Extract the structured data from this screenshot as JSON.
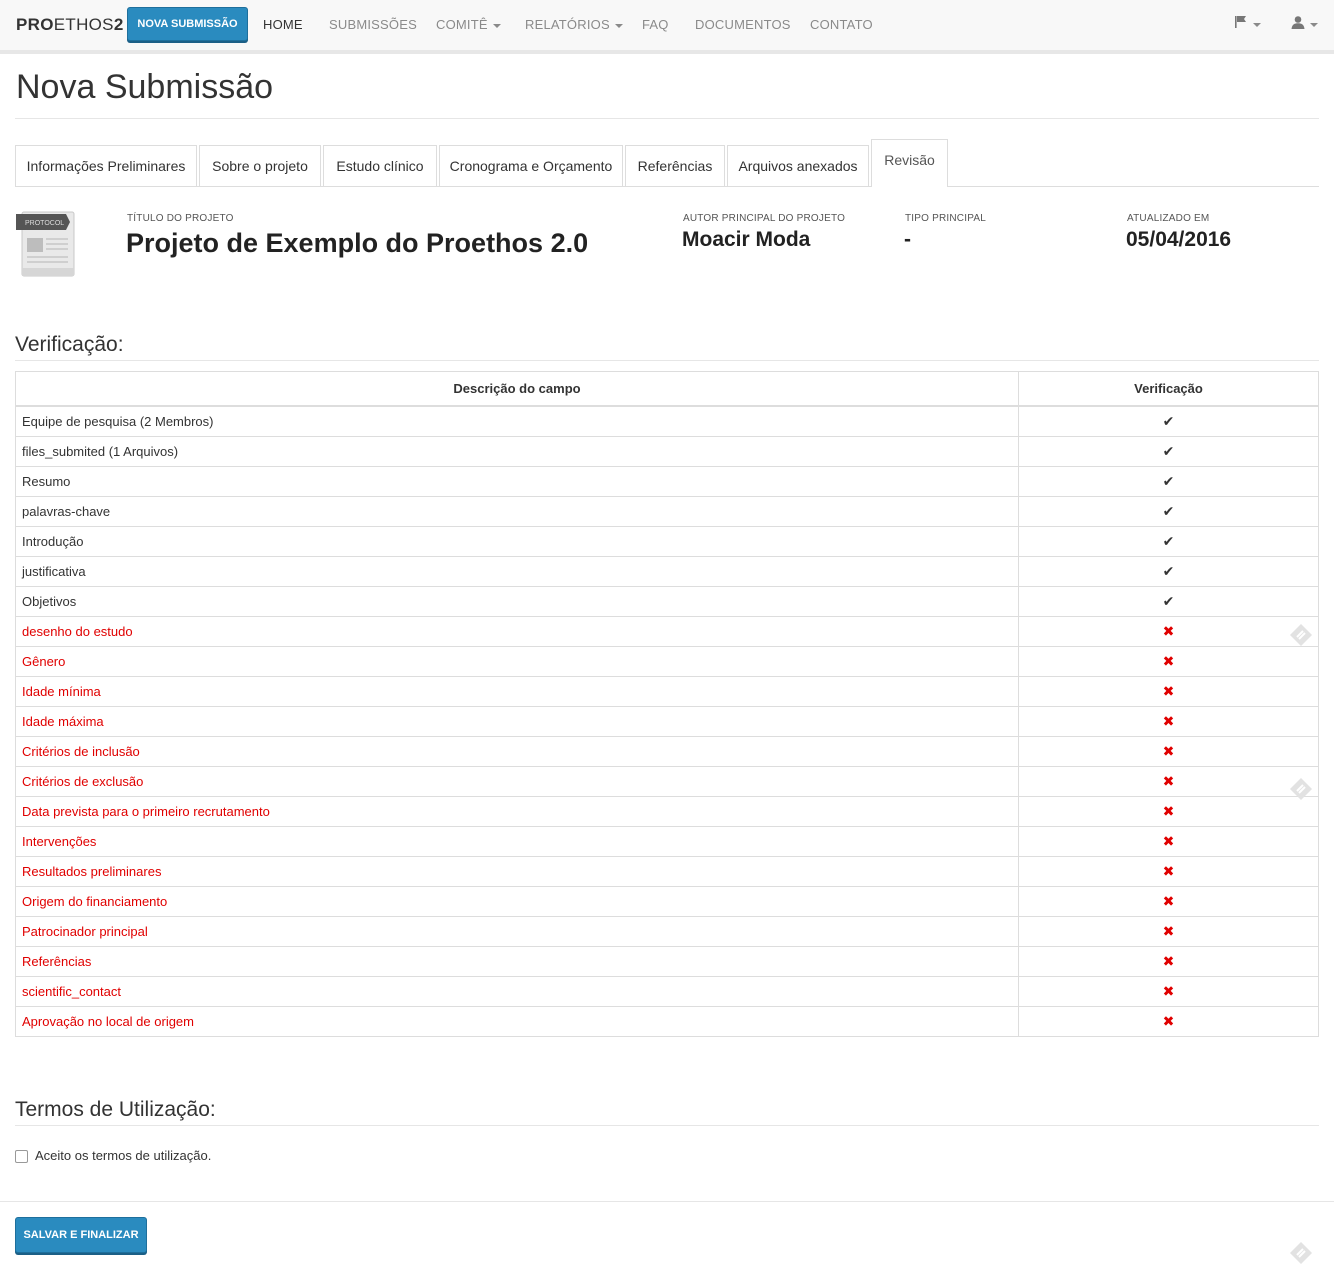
{
  "navbar": {
    "brand_bold": "PRO",
    "brand_thin": "ETHOS",
    "brand_bold2": "2",
    "nova_submissao": "NOVA SUBMISSÃO",
    "items": [
      "HOME",
      "SUBMISSÕES",
      "COMITÊ",
      "RELATÓRIOS",
      "FAQ",
      "DOCUMENTOS",
      "CONTATO"
    ],
    "icons": [
      "flag-icon",
      "user-icon"
    ]
  },
  "page": {
    "title": "Nova Submissão"
  },
  "tabs": [
    "Informações Preliminares",
    "Sobre o projeto",
    "Estudo clínico",
    "Cronograma e Orçamento",
    "Referências",
    "Arquivos anexados",
    "Revisão"
  ],
  "active_tab": "Revisão",
  "project": {
    "icon_label": "PROTOCOL",
    "title_label": "TÍTULO DO PROJETO",
    "title": "Projeto de Exemplo do Proethos 2.0",
    "author_label": "AUTOR PRINCIPAL DO PROJETO",
    "author": "Moacir Moda",
    "type_label": "TIPO PRINCIPAL",
    "type": "-",
    "updated_label": "ATUALIZADO EM",
    "updated": "05/04/2016"
  },
  "verification": {
    "heading": "Verificação:",
    "col_desc": "Descrição do campo",
    "col_check": "Verificação",
    "rows": [
      {
        "desc": "Equipe de pesquisa (2 Membros)",
        "ok": true
      },
      {
        "desc": "files_submited (1 Arquivos)",
        "ok": true
      },
      {
        "desc": "Resumo",
        "ok": true
      },
      {
        "desc": "palavras-chave",
        "ok": true
      },
      {
        "desc": "Introdução",
        "ok": true
      },
      {
        "desc": "justificativa",
        "ok": true
      },
      {
        "desc": "Objetivos",
        "ok": true
      },
      {
        "desc": "desenho do estudo",
        "ok": false
      },
      {
        "desc": "Gênero",
        "ok": false
      },
      {
        "desc": "Idade mínima",
        "ok": false
      },
      {
        "desc": "Idade máxima",
        "ok": false
      },
      {
        "desc": "Critérios de inclusão",
        "ok": false
      },
      {
        "desc": "Critérios de exclusão",
        "ok": false
      },
      {
        "desc": "Data prevista para o primeiro recrutamento",
        "ok": false
      },
      {
        "desc": "Intervenções",
        "ok": false
      },
      {
        "desc": "Resultados preliminares",
        "ok": false
      },
      {
        "desc": "Origem do financiamento",
        "ok": false
      },
      {
        "desc": "Patrocinador principal",
        "ok": false
      },
      {
        "desc": "Referências",
        "ok": false
      },
      {
        "desc": "scientific_contact",
        "ok": false
      },
      {
        "desc": "Aprovação no local de origem",
        "ok": false
      }
    ],
    "ok_glyph": "✔",
    "bad_glyph": "✖"
  },
  "terms": {
    "heading": "Termos de Utilização:",
    "checkbox_label": "Aceito os termos de utilização.",
    "checked": false
  },
  "actions": {
    "save_label": "SALVAR E FINALIZAR"
  },
  "colors": {
    "primary": "#2a8bbf",
    "error": "#e00000",
    "nav_bg": "#f8f8f8"
  }
}
